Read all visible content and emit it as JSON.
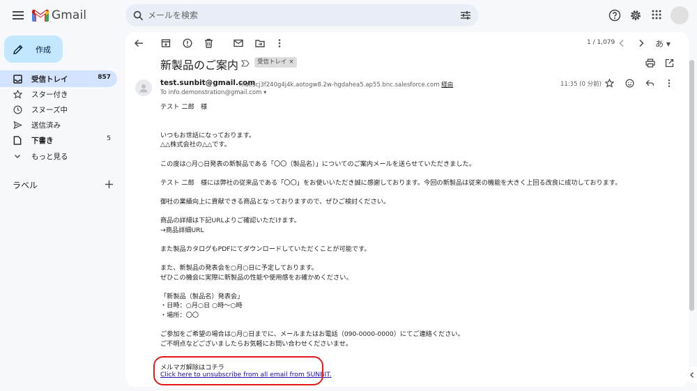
{
  "app": {
    "brand": "Gmail"
  },
  "search": {
    "placeholder": "メールを検索"
  },
  "compose": {
    "label": "作成"
  },
  "sidebar": {
    "items": [
      {
        "label": "受信トレイ",
        "count": "857",
        "icon": "inbox-icon",
        "active": true
      },
      {
        "label": "スター付き",
        "count": "",
        "icon": "star-icon"
      },
      {
        "label": "スヌーズ中",
        "count": "",
        "icon": "clock-icon"
      },
      {
        "label": "送信済み",
        "count": "",
        "icon": "send-icon"
      },
      {
        "label": "下書き",
        "count": "5",
        "icon": "draft-icon"
      },
      {
        "label": "もっと見る",
        "count": "",
        "icon": "chevron-down-icon"
      }
    ],
    "labels_title": "ラベル"
  },
  "toolbar": {
    "pager": "1 / 1,079",
    "lang": "あ ▾"
  },
  "email": {
    "subject": "新製品のご案内",
    "label_chip": "受信トレイ",
    "label_chip_close": "×",
    "sender_name": "test.sunbit@gmail.com",
    "sender_via": "muescj3f240g4j4k.aotogw8.2w-hgdahea5.ap55.bnc.salesforce.com",
    "via_word": "経由",
    "to": "To info.demonstration@gmail.com",
    "time": "11:35 (0 分前)",
    "body": [
      "テスト 二郎　様",
      "",
      "",
      "いつもお世話になっております。",
      "△△株式会社の△△です。",
      "",
      "この度は○月○日発表の新製品である「〇〇（製品名）」についてのご案内メールを送らせていただきました。",
      "",
      "テスト 二郎　様には弊社の従来品である「〇〇」をお使いいただき誠に感謝しております。今回の新製品は従来の機能を大きく上回る改良に成功しております。",
      "",
      "御社の業績向上に貢献できる商品となっておりますので、ぜひご検討ください。",
      "",
      "商品の詳細は下記URLよりご確認いただけます。",
      "→商品詳細URL",
      "",
      "また製品カタログもPDFにてダウンロードしていただくことが可能です。",
      "",
      "また、新製品の発表会を○月○日に予定しております。",
      "ぜひこの機会に実際に新製品の性能や使用感をお確かめください。",
      "",
      "「新製品（製品名）発表会」",
      "・日時：○月○日 ○時〜○時",
      "・場所：〇〇",
      "",
      "ご参加をご希望の場合は○月○日までに、メールまたはお電話（090-0000-0000）にてご連絡ください。",
      "ご不明点などございましたらお気軽にお問い合わせくださいませ。"
    ],
    "unsubscribe_title": "メルマガ解除はコチラ",
    "unsubscribe_link": "Click here to unsubscribe from all email from SUNBIT."
  },
  "colors": {
    "accent": "#c2e7ff",
    "active_nav": "#d3e3fd",
    "highlight": "#e61919",
    "link": "#1a0dab"
  }
}
